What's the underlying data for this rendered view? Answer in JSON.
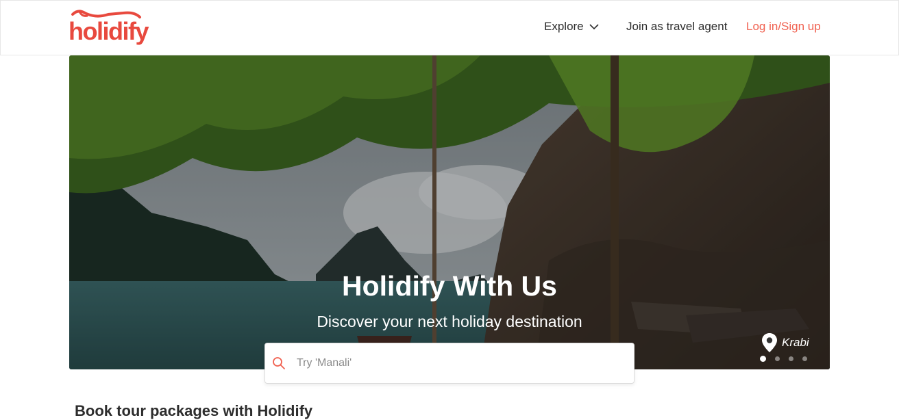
{
  "header": {
    "logo_text": "holidify",
    "nav": {
      "explore_label": "Explore",
      "agent_label": "Join as travel agent",
      "login_label": "Log in/Sign up"
    }
  },
  "hero": {
    "title": "Holidify With Us",
    "subtitle": "Discover your next holiday destination",
    "location": "Krabi",
    "carousel": {
      "total": 4,
      "active_index": 0
    }
  },
  "search": {
    "placeholder": "Try 'Manali'",
    "value": ""
  },
  "section": {
    "title": "Book tour packages with Holidify"
  },
  "colors": {
    "brand": "#e8493e",
    "login": "#f0604f",
    "search_icon": "#f0604f"
  },
  "icons": [
    "logo-swoosh-icon",
    "chevron-down-icon",
    "location-pin-icon",
    "search-icon"
  ]
}
